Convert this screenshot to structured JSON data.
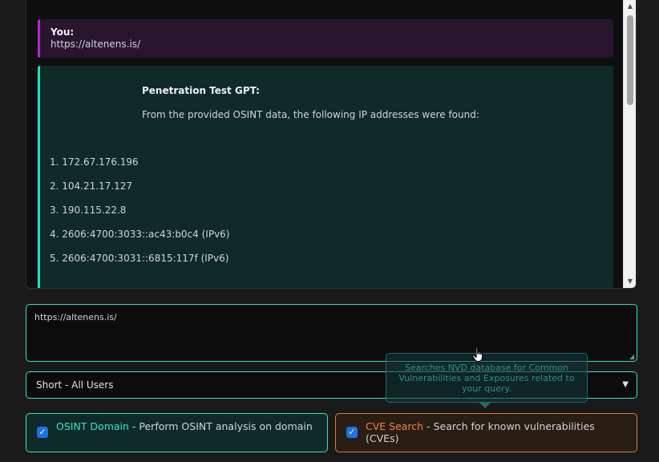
{
  "chat": {
    "user": {
      "label": "You:",
      "text": "https://altenens.is/"
    },
    "assistant": {
      "label": "Penetration Test GPT:",
      "intro": "From the provided OSINT data, the following IP addresses were found:",
      "ips": [
        "1. 172.67.176.196",
        "2. 104.21.17.127",
        "3. 190.115.22.8",
        "4. 2606:4700:3033::ac43:b0c4 (IPv6)",
        "5. 2606:4700:3031::6815:117f (IPv6)"
      ]
    }
  },
  "input": {
    "value": "https://altenens.is/"
  },
  "mode_select": {
    "selected": "Short - All Users"
  },
  "tooltip": {
    "text": "Searches NVD database for Common Vulnerabilities and Exposures related to your query."
  },
  "tools": {
    "osint": {
      "name": "OSINT Domain",
      "desc": " - Perform OSINT analysis on domain",
      "checked": true
    },
    "cve": {
      "name": "CVE Search",
      "desc": " - Search for known vulnerabilities (CVEs)",
      "checked": true
    }
  },
  "colors": {
    "accent_teal": "#2ee6cc",
    "accent_orange": "#e07a3a",
    "user_accent": "#b02ad0"
  }
}
